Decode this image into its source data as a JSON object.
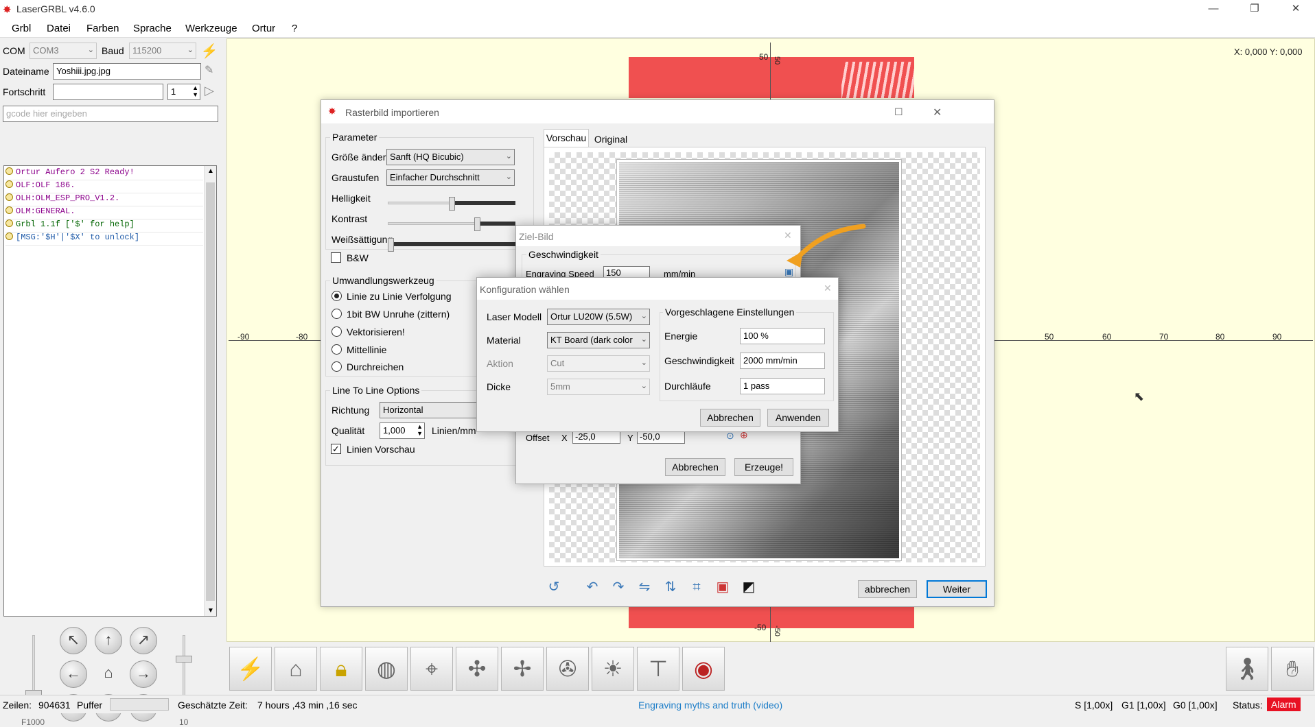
{
  "app": {
    "title": "LaserGRBL v4.6.0"
  },
  "menu": [
    "Grbl",
    "Datei",
    "Farben",
    "Sprache",
    "Werkzeuge",
    "Ortur",
    "?"
  ],
  "connection": {
    "com_label": "COM",
    "com_value": "COM3",
    "baud_label": "Baud",
    "baud_value": "115200"
  },
  "file": {
    "label": "Dateiname",
    "value": "Yoshiii.jpg.jpg"
  },
  "progress": {
    "label": "Fortschritt",
    "count": "1"
  },
  "gcode_input": {
    "placeholder": "gcode hier eingeben"
  },
  "console_lines": [
    {
      "text": "Ortur Aufero 2 S2 Ready!",
      "color": "#8b008b"
    },
    {
      "text": "OLF:OLF 186.",
      "color": "#8b008b"
    },
    {
      "text": "OLH:OLM_ESP_PRO_V1.2.",
      "color": "#8b008b"
    },
    {
      "text": "OLM:GENERAL.",
      "color": "#8b008b"
    },
    {
      "text": "Grbl 1.1f ['$' for help]",
      "color": "#006400"
    },
    {
      "text": "[MSG:'$H'|'$X' to unlock]",
      "color": "#1e5aa8"
    }
  ],
  "jog": {
    "speed_label": "F1000",
    "step_label": "10"
  },
  "canvas": {
    "coords": "X: 0,000 Y: 0,000",
    "ticks_x": [
      "-90",
      "-80",
      "50",
      "60",
      "70",
      "80",
      "90"
    ],
    "ticks_y": [
      "50",
      "-50"
    ],
    "tick_side": [
      "50",
      "-50"
    ]
  },
  "status": {
    "lines_label": "Zeilen:",
    "lines_value": "904631",
    "buffer_label": "Puffer",
    "time_label": "Geschätzte Zeit:",
    "time_value": "7 hours ,43 min ,16 sec",
    "link": "Engraving myths and truth (video)",
    "s": "S [1,00x]",
    "g1": "G1 [1,00x]",
    "g0": "G0 [1,00x]",
    "status_label": "Status:",
    "status_value": "Alarm",
    "alarm_color": "#e81123"
  },
  "raster": {
    "title": "Rasterbild importieren",
    "params_title": "Parameter",
    "resize_label": "Größe ändern",
    "resize_value": "Sanft (HQ Bicubic)",
    "gray_label": "Graustufen",
    "gray_value": "Einfacher Durchschnitt",
    "brightness_label": "Helligkeit",
    "brightness_level": 0.5,
    "contrast_label": "Kontrast",
    "contrast_level": 0.7,
    "white_label": "Weißsättigung",
    "white_level": 0.0,
    "bw_label": "B&W",
    "tool_title": "Umwandlungswerkzeug",
    "tools": [
      "Linie zu Linie Verfolgung",
      "1bit BW Unruhe (zittern)",
      "Vektorisieren!",
      "Mittellinie",
      "Durchreichen"
    ],
    "ltl_title": "Line To Line Options",
    "direction_label": "Richtung",
    "direction_value": "Horizontal",
    "quality_label": "Qualität",
    "quality_value": "1,000",
    "quality_unit": "Linien/mm",
    "preview_label": "Linien Vorschau",
    "tab_preview": "Vorschau",
    "tab_original": "Original",
    "cancel": "abbrechen",
    "next": "Weiter"
  },
  "target": {
    "title": "Ziel-Bild",
    "speed_group": "Geschwindigkeit",
    "engraving_speed_label": "Engraving Speed",
    "engraving_speed_value": "150",
    "speed_unit": "mm/min",
    "offset_label": "Offset",
    "x_label": "X",
    "x_value": "-25,0",
    "y_label": "Y",
    "y_value": "-50,0",
    "cancel": "Abbrechen",
    "create": "Erzeuge!"
  },
  "config": {
    "title": "Konfiguration wählen",
    "laser_label": "Laser Modell",
    "laser_value": "Ortur LU20W (5.5W)",
    "material_label": "Material",
    "material_value": "KT Board (dark color",
    "action_label": "Aktion",
    "action_value": "Cut",
    "thickness_label": "Dicke",
    "thickness_value": "5mm",
    "suggest_title": "Vorgeschlagene Einstellungen",
    "energy_label": "Energie",
    "energy_value": "100 %",
    "speed_label": "Geschwindigkeit",
    "speed_value": "2000 mm/min",
    "passes_label": "Durchläufe",
    "passes_value": "1 pass",
    "cancel": "Abbrechen",
    "apply": "Anwenden"
  }
}
